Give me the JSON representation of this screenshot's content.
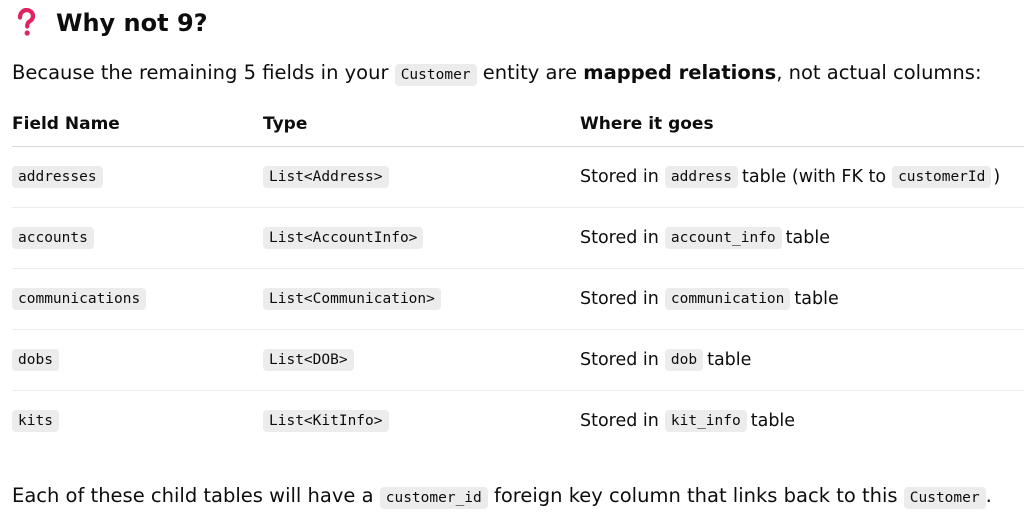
{
  "section": {
    "icon": "question-mark-icon",
    "heading": "Why not 9?"
  },
  "intro": {
    "prefix": "Because the remaining 5 fields in your ",
    "entity_code": "Customer",
    "middle": " entity are ",
    "bold": "mapped relations",
    "suffix": ", not actual columns:"
  },
  "table": {
    "headers": [
      "Field Name",
      "Type",
      "Where it goes"
    ],
    "rows": [
      {
        "field": "addresses",
        "type": "List<Address>",
        "pre": "Stored in",
        "table_code": "address",
        "post": "table (with FK to",
        "fk_code": "customerId",
        "end": ")"
      },
      {
        "field": "accounts",
        "type": "List<AccountInfo>",
        "pre": "Stored in",
        "table_code": "account_info",
        "post": "table"
      },
      {
        "field": "communications",
        "type": "List<Communication>",
        "pre": "Stored in",
        "table_code": "communication",
        "post": "table"
      },
      {
        "field": "dobs",
        "type": "List<DOB>",
        "pre": "Stored in",
        "table_code": "dob",
        "post": "table"
      },
      {
        "field": "kits",
        "type": "List<KitInfo>",
        "pre": "Stored in",
        "table_code": "kit_info",
        "post": "table"
      }
    ]
  },
  "footer": {
    "prefix": "Each of these child tables will have a ",
    "fk_code": "customer_id",
    "middle": " foreign key column that links back to this ",
    "entity_code": "Customer",
    "suffix": "."
  },
  "colors": {
    "icon_red": "#e0245e",
    "code_bg": "#ececec",
    "divider": "#d9d9d9"
  }
}
